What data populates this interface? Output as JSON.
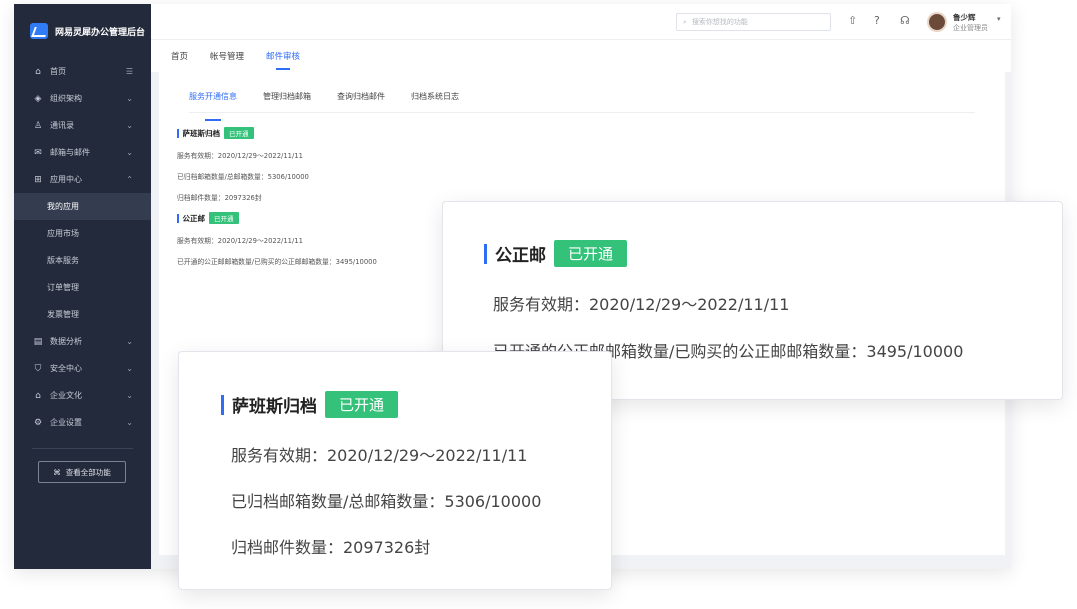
{
  "brand": {
    "title": "网易灵犀办公管理后台"
  },
  "sidebar": {
    "collapse_icon": "menu-fold-icon",
    "items": [
      {
        "label": "首页",
        "icon": "home-icon"
      },
      {
        "label": "组织架构",
        "icon": "org-icon"
      },
      {
        "label": "通讯录",
        "icon": "contacts-icon"
      },
      {
        "label": "邮箱与邮件",
        "icon": "mail-icon"
      },
      {
        "label": "应用中心",
        "icon": "apps-icon"
      },
      {
        "label": "我的应用"
      },
      {
        "label": "应用市场"
      },
      {
        "label": "版本服务"
      },
      {
        "label": "订单管理"
      },
      {
        "label": "发票管理"
      },
      {
        "label": "数据分析",
        "icon": "chart-icon"
      },
      {
        "label": "安全中心",
        "icon": "shield-icon"
      },
      {
        "label": "企业文化",
        "icon": "culture-icon"
      },
      {
        "label": "企业设置",
        "icon": "settings-icon"
      }
    ],
    "all_functions": "查看全部功能"
  },
  "topbar": {
    "search_placeholder": "搜索你想找的功能",
    "user_name": "鲁少辉",
    "user_role": "企业管理员"
  },
  "tabs": [
    "首页",
    "帐号管理",
    "邮件审核"
  ],
  "subtabs": [
    "服务开通信息",
    "管理归档邮箱",
    "查询归档邮件",
    "归档系统日志"
  ],
  "archive": {
    "title": "萨班斯归档",
    "status": "已开通",
    "validity": "服务有效期：2020/12/29～2022/11/11",
    "mailbox_count": "已归档邮箱数量/总邮箱数量：5306/10000",
    "mail_count": "归档邮件数量：2097326封"
  },
  "notary": {
    "title": "公正邮",
    "status": "已开通",
    "validity": "服务有效期：2020/12/29～2022/11/11",
    "mailbox_count": "已开通的公正邮邮箱数量/已购买的公正邮邮箱数量：3495/10000"
  },
  "colors": {
    "accent": "#2f6df6",
    "success": "#34c27a",
    "sidebar": "#232a3b"
  }
}
